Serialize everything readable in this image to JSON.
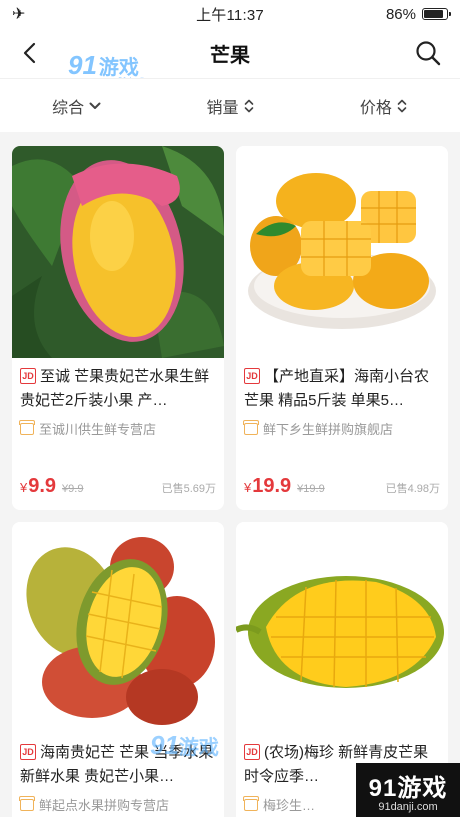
{
  "status_bar": {
    "airplane_icon": "airplane-icon",
    "time": "上午11:37",
    "battery_text": "86%",
    "battery_level": 0.86
  },
  "nav": {
    "title": "芒果",
    "back_icon": "chevron-left-icon",
    "search_icon": "search-icon"
  },
  "watermark": {
    "logo_num": "91",
    "logo_cn": "游戏",
    "url": "91danji.com"
  },
  "filters": [
    {
      "label": "综合",
      "icon": "chevron-down-icon"
    },
    {
      "label": "销量",
      "icon": "sort-icon"
    },
    {
      "label": "价格",
      "icon": "sort-icon"
    }
  ],
  "products": [
    {
      "title": "至诚 芒果贵妃芒水果生鲜 贵妃芒2斤装小果 产…",
      "badge": "JD",
      "shop": "至诚川供生鲜专营店",
      "price_currency": "¥",
      "price": "9.9",
      "old_price": "¥9.9",
      "sold": "已售5.69万"
    },
    {
      "title": "【产地直采】海南小台农芒果 精品5斤装 单果5…",
      "badge": "JD",
      "shop": "鲜下乡生鲜拼购旗舰店",
      "price_currency": "¥",
      "price": "19.9",
      "old_price": "¥19.9",
      "sold": "已售4.98万"
    },
    {
      "title": "海南贵妃芒 芒果 当季水果 新鲜水果 贵妃芒小果…",
      "badge": "JD",
      "shop": "鲜起点水果拼购专营店"
    },
    {
      "title": "(农场)梅珍 新鲜青皮芒果 时令应季…",
      "badge": "JD",
      "shop": "梅珍生…"
    }
  ],
  "colors": {
    "accent": "#e4393c",
    "shop_icon": "#f0b35a",
    "watermark": "#5ab2ff"
  }
}
